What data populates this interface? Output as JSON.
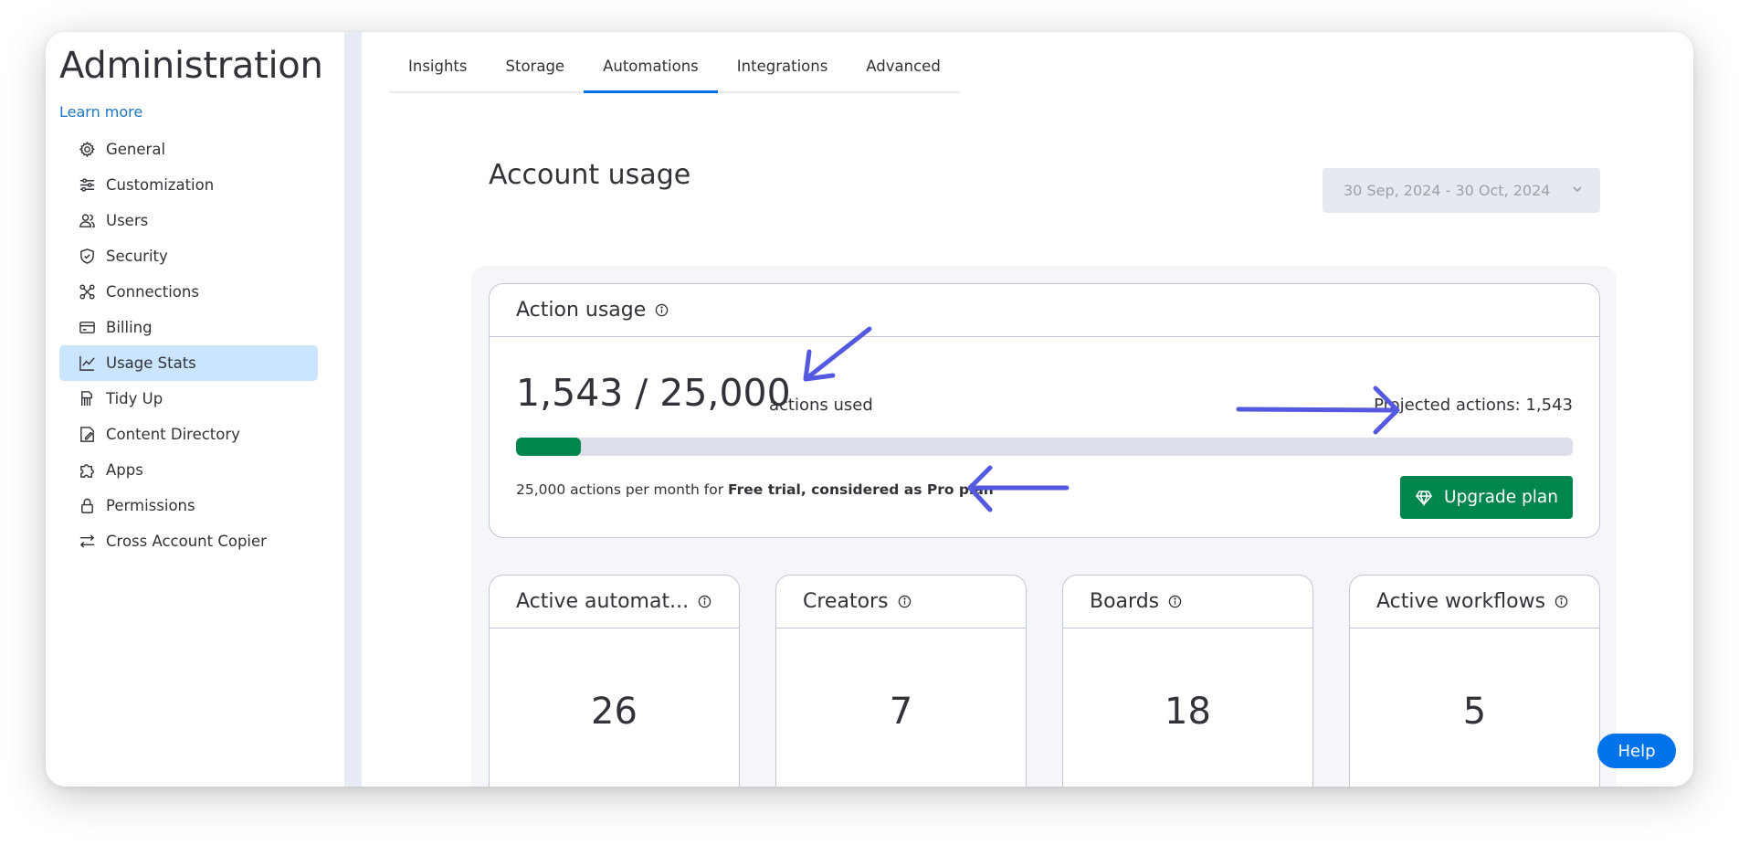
{
  "sidebar": {
    "title": "Administration",
    "learn_more": "Learn more",
    "items": [
      {
        "label": "General",
        "icon": "gear-icon"
      },
      {
        "label": "Customization",
        "icon": "sliders-icon"
      },
      {
        "label": "Users",
        "icon": "users-icon"
      },
      {
        "label": "Security",
        "icon": "shield-icon"
      },
      {
        "label": "Connections",
        "icon": "connections-icon"
      },
      {
        "label": "Billing",
        "icon": "credit-card-icon"
      },
      {
        "label": "Usage Stats",
        "icon": "chart-icon",
        "active": true
      },
      {
        "label": "Tidy Up",
        "icon": "broom-icon"
      },
      {
        "label": "Content Directory",
        "icon": "directory-icon"
      },
      {
        "label": "Apps",
        "icon": "puzzle-icon"
      },
      {
        "label": "Permissions",
        "icon": "lock-icon"
      },
      {
        "label": "Cross Account Copier",
        "icon": "arrows-icon"
      }
    ]
  },
  "tabs": [
    {
      "label": "Insights"
    },
    {
      "label": "Storage"
    },
    {
      "label": "Automations",
      "active": true
    },
    {
      "label": "Integrations"
    },
    {
      "label": "Advanced"
    }
  ],
  "main": {
    "title": "Account usage",
    "date_range": "30 Sep, 2024 - 30 Oct, 2024"
  },
  "action_usage": {
    "title": "Action usage",
    "used_display": "1,543 / 25,000",
    "suffix": "actions used",
    "projected": "Projected actions: 1,543",
    "progress_fraction": 0.0617,
    "plan_prefix": "25,000 actions per month for ",
    "plan_name": "Free trial, considered as Pro plan",
    "upgrade_label": "Upgrade plan"
  },
  "stats": [
    {
      "title": "Active automat...",
      "value": "26"
    },
    {
      "title": "Creators",
      "value": "7"
    },
    {
      "title": "Boards",
      "value": "18"
    },
    {
      "title": "Active workflows",
      "value": "5"
    }
  ],
  "help_label": "Help",
  "colors": {
    "accent": "#0073ea",
    "success": "#00854d",
    "annotation_arrow": "#5559df",
    "active_nav": "#cce5ff"
  }
}
